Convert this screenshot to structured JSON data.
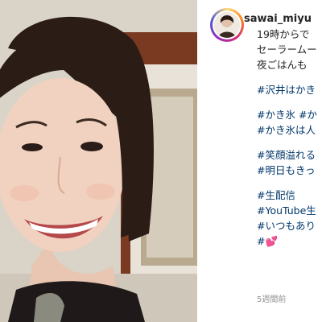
{
  "post": {
    "username": "sawai_miyu",
    "caption_lines": [
      {
        "text": "19時からで",
        "type": "text"
      },
      {
        "text": "セーラームー",
        "type": "text"
      },
      {
        "text": "夜ごはんも",
        "type": "text"
      },
      {
        "text": "",
        "type": "gap"
      },
      {
        "text": "#沢井はかき",
        "type": "tag"
      },
      {
        "text": "",
        "type": "gap"
      },
      {
        "text": "#かき氷 #か",
        "type": "tag"
      },
      {
        "text": "#かき氷は人",
        "type": "tag"
      },
      {
        "text": "",
        "type": "gap"
      },
      {
        "text": "#笑顔溢れる",
        "type": "tag"
      },
      {
        "text": "#明日もきっ",
        "type": "tag"
      },
      {
        "text": "",
        "type": "gap"
      },
      {
        "text": "#生配信",
        "type": "tag"
      },
      {
        "text": "#YouTube生",
        "type": "tag"
      },
      {
        "text": "#いつもあり",
        "type": "tag"
      },
      {
        "text": "#",
        "type": "tag"
      }
    ],
    "heart_emoji": "💕",
    "timestamp": "5週間前"
  },
  "colors": {
    "hashtag": "#00376b",
    "text": "#262626",
    "muted": "#8e8e8e",
    "heart": "#e23d8c"
  }
}
